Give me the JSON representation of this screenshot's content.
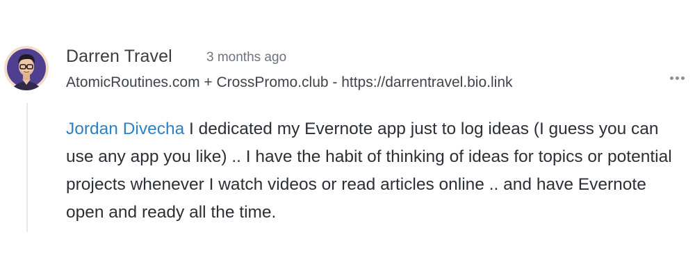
{
  "comment": {
    "author": "Darren Travel",
    "timestamp": "3 months ago",
    "bio": "AtomicRoutines.com + CrossPromo.club - https://darrentravel.bio.link",
    "mention": "Jordan Divecha",
    "text": " I dedicated my Evernote app just to log ideas (I guess you can use any app you like) .. I have the habit of thinking of ideas for topics or potential projects whenever I watch videos or read articles online .. and have Evernote open and ready all the time."
  },
  "icons": {
    "avatar": "avatar-illustration",
    "more": "more-options-icon"
  },
  "colors": {
    "mention": "#2f80c4",
    "avatar_bg": "#4f3f8f",
    "thread_line": "#e6e8eb"
  }
}
